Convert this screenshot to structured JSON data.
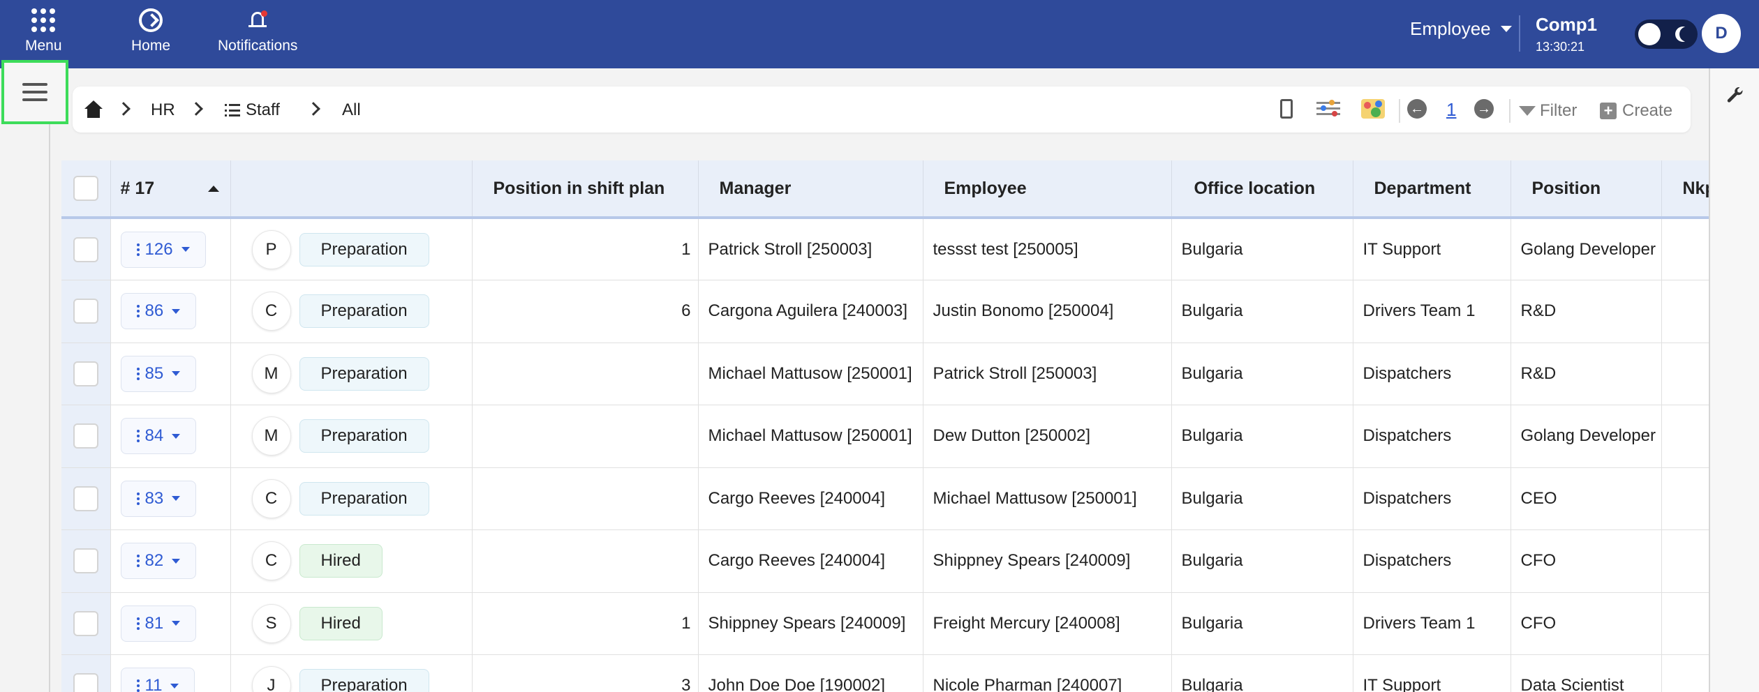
{
  "topbar": {
    "menu_label": "Menu",
    "home_label": "Home",
    "notifications_label": "Notifications",
    "role_select": "Employee",
    "company_name": "Comp1",
    "time": "13:30:21",
    "avatar_initial": "D",
    "bg_color": "#2f4a9a"
  },
  "breadcrumb": {
    "items": [
      "HR",
      "Staff",
      "All"
    ]
  },
  "toolbar": {
    "page_number": "1",
    "filter_label": "Filter",
    "create_label": "Create"
  },
  "table": {
    "headers": {
      "id": "# 17",
      "status": "",
      "position_in_shift_plan": "Position in shift plan",
      "manager": "Manager",
      "employee": "Employee",
      "office_location": "Office location",
      "department": "Department",
      "position": "Position",
      "extra": "Nkp"
    },
    "rows": [
      {
        "id": "126",
        "initial": "P",
        "status": "Preparation",
        "shift": "1",
        "manager": "Patrick Stroll [250003]",
        "employee": "tessst test [250005]",
        "office": "Bulgaria",
        "department": "IT Support",
        "position": "Golang Developer"
      },
      {
        "id": "86",
        "initial": "C",
        "status": "Preparation",
        "shift": "6",
        "manager": "Cargona Aguilera [240003]",
        "employee": "Justin Bonomo [250004]",
        "office": "Bulgaria",
        "department": "Drivers Team 1",
        "position": "R&D"
      },
      {
        "id": "85",
        "initial": "M",
        "status": "Preparation",
        "shift": "",
        "manager": "Michael Mattusow [250001]",
        "employee": "Patrick Stroll [250003]",
        "office": "Bulgaria",
        "department": "Dispatchers",
        "position": "R&D"
      },
      {
        "id": "84",
        "initial": "M",
        "status": "Preparation",
        "shift": "",
        "manager": "Michael Mattusow [250001]",
        "employee": "Dew Dutton [250002]",
        "office": "Bulgaria",
        "department": "Dispatchers",
        "position": "Golang Developer"
      },
      {
        "id": "83",
        "initial": "C",
        "status": "Preparation",
        "shift": "",
        "manager": "Cargo Reeves [240004]",
        "employee": "Michael Mattusow [250001]",
        "office": "Bulgaria",
        "department": "Dispatchers",
        "position": "CEO"
      },
      {
        "id": "82",
        "initial": "C",
        "status": "Hired",
        "shift": "",
        "manager": "Cargo Reeves [240004]",
        "employee": "Shippney Spears [240009]",
        "office": "Bulgaria",
        "department": "Dispatchers",
        "position": "CFO"
      },
      {
        "id": "81",
        "initial": "S",
        "status": "Hired",
        "shift": "1",
        "manager": "Shippney Spears [240009]",
        "employee": "Freight Mercury [240008]",
        "office": "Bulgaria",
        "department": "Drivers Team 1",
        "position": "CFO"
      },
      {
        "id": "11",
        "initial": "J",
        "status": "Preparation",
        "shift": "3",
        "manager": "John Doe Doe [190002]",
        "employee": "Nicole Pharman [240007]",
        "office": "Bulgaria",
        "department": "IT Support",
        "position": "Data Scientist"
      }
    ]
  }
}
